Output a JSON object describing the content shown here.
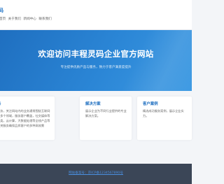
{
  "header": {
    "logo_text": "码",
    "nav": [
      "首页",
      "关于我们",
      "新闻中心",
      "联系我们"
    ]
  },
  "hero": {
    "title": "欢迎访问丰程灵码企业官方网站",
    "subtitle": "专注提供优质产品与服务，致力于客户满意度提升"
  },
  "cards": [
    {
      "title": "务",
      "text": "服务，关注网站内的业务通常围绕互联网等多个领域，服务客户覆盖，社交媒体等各类，云计算，大数据处理等全线产品等相关服务确保品质客户的多种高效需"
    },
    {
      "title": "解决方案",
      "text": "展示企业为不同行业提供的专业解决方案。"
    },
    {
      "title": "客户案例",
      "text": "精选成功服务案例，展示企业实力。"
    }
  ],
  "footer": {
    "link": "网站备案号：京ICP备1234567890号"
  }
}
